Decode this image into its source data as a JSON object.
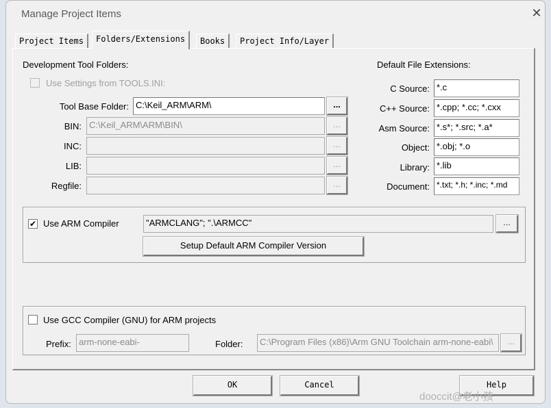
{
  "window": {
    "title": "Manage Project Items",
    "close": "✕"
  },
  "tabs": [
    "Project Items",
    "Folders/Extensions",
    "Books",
    "Project Info/Layer"
  ],
  "tool_folders": {
    "heading": "Development Tool Folders:",
    "use_tools_ini": {
      "label": "Use Settings from TOOLS.INI:",
      "checked": false,
      "enabled": false
    },
    "rows": [
      {
        "label": "Tool Base Folder:",
        "value": "C:\\Keil_ARM\\ARM\\",
        "browse": "..."
      },
      {
        "label": "BIN:",
        "value": "C:\\Keil_ARM\\ARM\\BIN\\",
        "browse": "..."
      },
      {
        "label": "INC:",
        "value": "",
        "browse": "..."
      },
      {
        "label": "LIB:",
        "value": "",
        "browse": "..."
      },
      {
        "label": "Regfile:",
        "value": "",
        "browse": "..."
      }
    ]
  },
  "extensions": {
    "heading": "Default File Extensions:",
    "rows": [
      {
        "label": "C Source:",
        "value": "*.c"
      },
      {
        "label": "C++ Source:",
        "value": "*.cpp; *.cc; *.cxx"
      },
      {
        "label": "Asm Source:",
        "value": "*.s*; *.src; *.a*"
      },
      {
        "label": "Object:",
        "value": "*.obj; *.o"
      },
      {
        "label": "Library:",
        "value": "*.lib"
      },
      {
        "label": "Document:",
        "value": "*.txt; *.h; *.inc; *.md"
      }
    ]
  },
  "arm": {
    "label": "Use ARM Compiler",
    "checked": true,
    "check": "✔",
    "value": "\"ARMCLANG\"; \".\\ARMCC\"",
    "browse": "...",
    "setup": "Setup Default ARM Compiler Version"
  },
  "gcc": {
    "label": "Use GCC Compiler (GNU) for ARM projects",
    "checked": false,
    "prefix_label": "Prefix:",
    "prefix": "arm-none-eabi-",
    "folder_label": "Folder:",
    "folder": "C:\\Program Files (x86)\\Arm GNU Toolchain arm-none-eabi\\",
    "browse": "..."
  },
  "buttons": {
    "ok": "OK",
    "cancel": "Cancel",
    "help": "Help"
  },
  "watermark": "dooccit@老小孩"
}
